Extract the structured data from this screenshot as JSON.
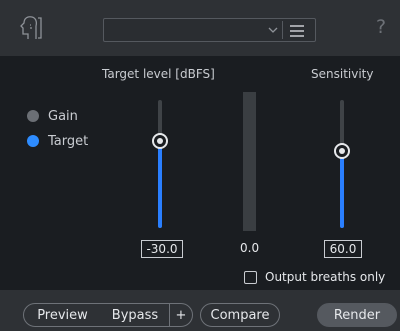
{
  "header": {
    "logo_icon": "breath-control-module-icon",
    "preset_value": "",
    "help_label": "?"
  },
  "labels": {
    "target_level": "Target level [dBFS]",
    "sensitivity": "Sensitivity"
  },
  "modes": [
    {
      "label": "Gain",
      "selected": false
    },
    {
      "label": "Target",
      "selected": true
    }
  ],
  "target_level": {
    "value": "-30.0",
    "level_fraction": 0.68
  },
  "meter": {
    "value": "0.0"
  },
  "sensitivity": {
    "value": "60.0",
    "level_fraction": 0.6
  },
  "output_breaths_only": {
    "label": "Output breaths only",
    "checked": false
  },
  "footer": {
    "preview": "Preview",
    "bypass": "Bypass",
    "plus": "+",
    "compare": "Compare",
    "render": "Render"
  },
  "colors": {
    "accent": "#2e8cff",
    "background": "#1a1d21",
    "bar": "#2e3135"
  }
}
